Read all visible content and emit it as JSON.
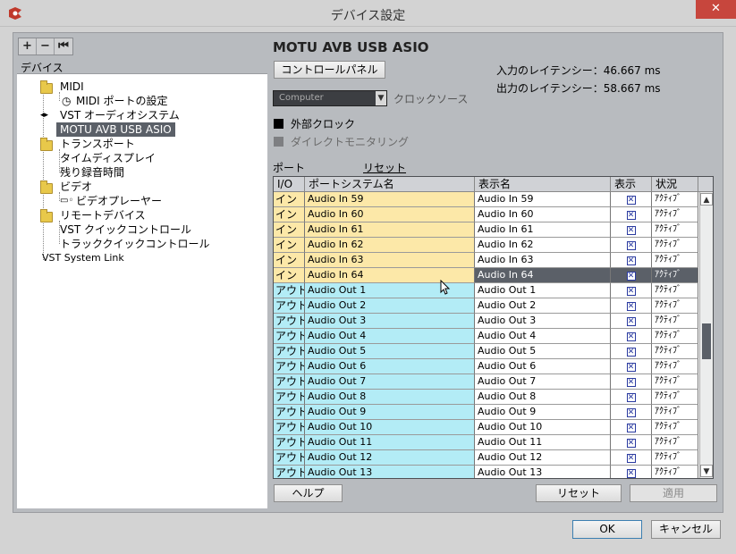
{
  "window": {
    "title": "デバイス設定",
    "close": "✕"
  },
  "tree_toolbar": [
    "+",
    "−",
    "⏮"
  ],
  "tree_header": "デバイス",
  "tree": [
    {
      "label": "MIDI",
      "icon": "folder-icon"
    },
    {
      "label": "MIDI ポートの設定",
      "icon": "midi-port-icon"
    },
    {
      "label": "VST オーディオシステム",
      "icon": "vst-audio-icon"
    },
    {
      "label": "MOTU AVB USB ASIO",
      "icon": ""
    },
    {
      "label": "トランスポート",
      "icon": "folder-icon"
    },
    {
      "label": "タイムディスプレイ",
      "icon": ""
    },
    {
      "label": "残り録音時間",
      "icon": ""
    },
    {
      "label": "ビデオ",
      "icon": "folder-icon"
    },
    {
      "label": "ビデオプレーヤー",
      "icon": "video-player-icon"
    },
    {
      "label": "リモートデバイス",
      "icon": "folder-icon"
    },
    {
      "label": "VST クイックコントロール",
      "icon": ""
    },
    {
      "label": "トラッククイックコントロール",
      "icon": ""
    },
    {
      "label": "VST System Link",
      "icon": ""
    }
  ],
  "device": {
    "title": "MOTU AVB USB ASIO",
    "control_panel": "コントロールパネル",
    "input_latency": "入力のレイテンシー：46.667 ms",
    "output_latency": "出力のレイテンシー：58.667 ms",
    "clock_source_value": "Computer",
    "clock_source_label": "クロックソース",
    "external_clock": "外部クロック",
    "direct_monitoring": "ダイレクトモニタリング",
    "ports_label": "ポート",
    "ports_reset": "リセット"
  },
  "grid": {
    "headers": [
      "I/O",
      "ポートシステム名",
      "表示名",
      "表示",
      "状況"
    ],
    "rows": [
      {
        "io": "イン",
        "system": "Audio In 59",
        "display": "Audio In 59",
        "visible": "✕",
        "status": "ｱｸﾃｨﾌﾞ",
        "kind": "in"
      },
      {
        "io": "イン",
        "system": "Audio In 60",
        "display": "Audio In 60",
        "visible": "✕",
        "status": "ｱｸﾃｨﾌﾞ",
        "kind": "in"
      },
      {
        "io": "イン",
        "system": "Audio In 61",
        "display": "Audio In 61",
        "visible": "✕",
        "status": "ｱｸﾃｨﾌﾞ",
        "kind": "in"
      },
      {
        "io": "イン",
        "system": "Audio In 62",
        "display": "Audio In 62",
        "visible": "✕",
        "status": "ｱｸﾃｨﾌﾞ",
        "kind": "in"
      },
      {
        "io": "イン",
        "system": "Audio In 63",
        "display": "Audio In 63",
        "visible": "✕",
        "status": "ｱｸﾃｨﾌﾞ",
        "kind": "in"
      },
      {
        "io": "イン",
        "system": "Audio In 64",
        "display": "Audio In 64",
        "visible": "✕",
        "status": "ｱｸﾃｨﾌﾞ",
        "kind": "in",
        "highlight": true
      },
      {
        "io": "アウト",
        "system": "Audio Out 1",
        "display": "Audio Out 1",
        "visible": "✕",
        "status": "ｱｸﾃｨﾌﾞ",
        "kind": "out"
      },
      {
        "io": "アウト",
        "system": "Audio Out 2",
        "display": "Audio Out 2",
        "visible": "✕",
        "status": "ｱｸﾃｨﾌﾞ",
        "kind": "out"
      },
      {
        "io": "アウト",
        "system": "Audio Out 3",
        "display": "Audio Out 3",
        "visible": "✕",
        "status": "ｱｸﾃｨﾌﾞ",
        "kind": "out"
      },
      {
        "io": "アウト",
        "system": "Audio Out 4",
        "display": "Audio Out 4",
        "visible": "✕",
        "status": "ｱｸﾃｨﾌﾞ",
        "kind": "out"
      },
      {
        "io": "アウト",
        "system": "Audio Out 5",
        "display": "Audio Out 5",
        "visible": "✕",
        "status": "ｱｸﾃｨﾌﾞ",
        "kind": "out"
      },
      {
        "io": "アウト",
        "system": "Audio Out 6",
        "display": "Audio Out 6",
        "visible": "✕",
        "status": "ｱｸﾃｨﾌﾞ",
        "kind": "out"
      },
      {
        "io": "アウト",
        "system": "Audio Out 7",
        "display": "Audio Out 7",
        "visible": "✕",
        "status": "ｱｸﾃｨﾌﾞ",
        "kind": "out"
      },
      {
        "io": "アウト",
        "system": "Audio Out 8",
        "display": "Audio Out 8",
        "visible": "✕",
        "status": "ｱｸﾃｨﾌﾞ",
        "kind": "out"
      },
      {
        "io": "アウト",
        "system": "Audio Out 9",
        "display": "Audio Out 9",
        "visible": "✕",
        "status": "ｱｸﾃｨﾌﾞ",
        "kind": "out"
      },
      {
        "io": "アウト",
        "system": "Audio Out 10",
        "display": "Audio Out 10",
        "visible": "✕",
        "status": "ｱｸﾃｨﾌﾞ",
        "kind": "out"
      },
      {
        "io": "アウト",
        "system": "Audio Out 11",
        "display": "Audio Out 11",
        "visible": "✕",
        "status": "ｱｸﾃｨﾌﾞ",
        "kind": "out"
      },
      {
        "io": "アウト",
        "system": "Audio Out 12",
        "display": "Audio Out 12",
        "visible": "✕",
        "status": "ｱｸﾃｨﾌﾞ",
        "kind": "out"
      },
      {
        "io": "アウト",
        "system": "Audio Out 13",
        "display": "Audio Out 13",
        "visible": "✕",
        "status": "ｱｸﾃｨﾌﾞ",
        "kind": "out"
      }
    ]
  },
  "buttons": {
    "help": "ヘルプ",
    "reset": "リセット",
    "apply": "適用",
    "ok": "OK",
    "cancel": "キャンセル"
  },
  "colors": {
    "in_row": "#fce8a8",
    "out_row": "#b3ecf6",
    "selection": "#5b6068",
    "close": "#c7463d"
  }
}
